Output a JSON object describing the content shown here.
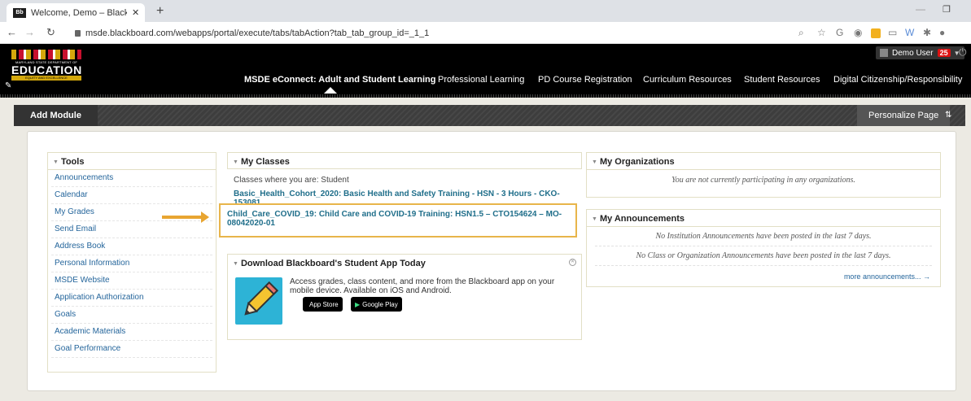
{
  "browser": {
    "tab_title": "Welcome, Demo – Blackboard Le",
    "tab_close": "✕",
    "favicon_text": "Bb",
    "new_tab": "+",
    "url": "msde.blackboard.com/webapps/portal/execute/tabs/tabAction?tab_tab_group_id=_1_1",
    "minimize": "—",
    "maximize": "❐"
  },
  "header": {
    "logo_sub": "MARYLAND STATE DEPARTMENT OF",
    "logo_main": "EDUCATION",
    "logo_tag": "EQUITY AND EXCELLENCE",
    "user_name": "Demo User",
    "user_badge": "25",
    "nav": [
      {
        "label": "MSDE eConnect: Adult and Student Learning"
      },
      {
        "label": "Professional Learning"
      },
      {
        "label": "PD Course Registration"
      },
      {
        "label": "Curriculum Resources"
      },
      {
        "label": "Student Resources"
      },
      {
        "label": "Digital Citizenship/Responsibility"
      }
    ]
  },
  "modbar": {
    "add_module": "Add Module",
    "personalize": "Personalize Page",
    "reorder": "⇅"
  },
  "tools": {
    "title": "Tools",
    "items": [
      "Announcements",
      "Calendar",
      "My Grades",
      "Send Email",
      "Address Book",
      "Personal Information",
      "MSDE Website",
      "Application Authorization",
      "Goals",
      "Academic Materials",
      "Goal Performance"
    ]
  },
  "classes": {
    "title": "My Classes",
    "subtitle": "Classes where you are: Student",
    "items": [
      "Basic_Health_Cohort_2020: Basic Health and Safety Training - HSN - 3 Hours - CKO- 153081",
      "Child_Care_COVID_19: Child Care and COVID-19 Training: HSN1.5 – CTO154624 – MO-08042020-01"
    ]
  },
  "app": {
    "title": "Download Blackboard's Student App Today",
    "text": "Access grades, class content, and more from the Blackboard app on your mobile device. Available on iOS and Android.",
    "app_store": "App Store",
    "google_play": "Google Play"
  },
  "organizations": {
    "title": "My Organizations",
    "message": "You are not currently participating in any organizations."
  },
  "announcements": {
    "title": "My Announcements",
    "msg1": "No Institution Announcements have been posted in the last 7 days.",
    "msg2": "No Class or Organization Announcements have been posted in the last 7 days.",
    "more": "more announcements... →"
  }
}
